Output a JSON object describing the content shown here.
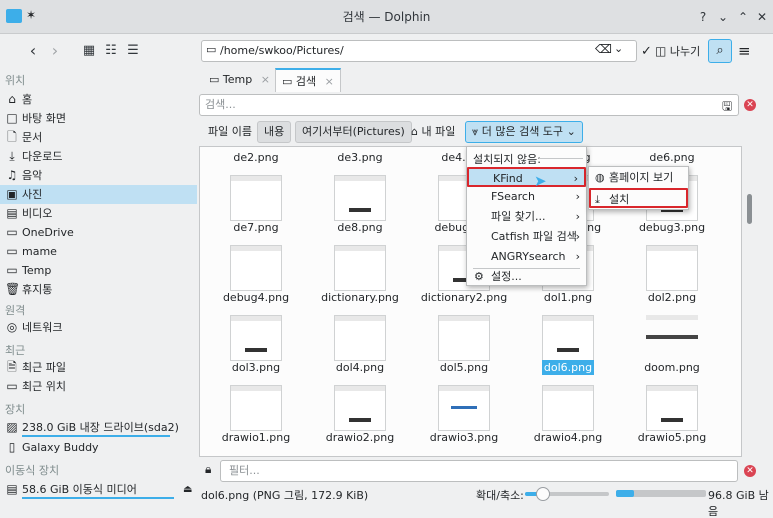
{
  "window": {
    "title": "검색 — Dolphin",
    "controls": [
      "?",
      "⌄",
      "⌃",
      "✕"
    ]
  },
  "toolbar": {
    "path": "/home/swkoo/Pictures/",
    "split_label": "나누기"
  },
  "sidebar": {
    "places_title": "위치",
    "places": [
      {
        "label": "홈",
        "icon": "⌂"
      },
      {
        "label": "바탕 화면",
        "icon": "□"
      },
      {
        "label": "문서",
        "icon": "🗋"
      },
      {
        "label": "다운로드",
        "icon": "⤓"
      },
      {
        "label": "음악",
        "icon": "♫"
      },
      {
        "label": "사진",
        "icon": "▣"
      },
      {
        "label": "비디오",
        "icon": "▤"
      },
      {
        "label": "OneDrive",
        "icon": "▭"
      },
      {
        "label": "mame",
        "icon": "▭"
      },
      {
        "label": "Temp",
        "icon": "▭"
      },
      {
        "label": "휴지통",
        "icon": "🗑"
      }
    ],
    "remote_title": "원격",
    "remote": [
      {
        "label": "네트워크",
        "icon": "◎"
      }
    ],
    "recent_title": "최근",
    "recent": [
      {
        "label": "최근 파일",
        "icon": "🗎"
      },
      {
        "label": "최근 위치",
        "icon": "▭"
      }
    ],
    "devices_title": "장치",
    "devices": [
      {
        "label": "238.0 GiB 내장 드라이브(sda2)",
        "icon": "▨"
      },
      {
        "label": "Galaxy Buddy",
        "icon": "▯"
      }
    ],
    "removable_title": "이동식 장치",
    "removable": [
      {
        "label": "58.6 GiB 이동식 미디어",
        "icon": "▤"
      }
    ]
  },
  "tabs": [
    {
      "label": "Temp",
      "icon": "▭"
    },
    {
      "label": "검색",
      "icon": "▭"
    }
  ],
  "search": {
    "placeholder": "검색..."
  },
  "filter_row": {
    "label_filename": "파일 이름",
    "label_content": "내용",
    "label_from_here": "여기서부터(Pictures)",
    "label_my_files": "내 파일",
    "label_more_tools": "더 많은 검색 도구"
  },
  "files": [
    {
      "name": "de2.png"
    },
    {
      "name": "de3.png"
    },
    {
      "name": "de4.png"
    },
    {
      "name": "de5.png"
    },
    {
      "name": "de6.png"
    },
    {
      "name": "de7.png"
    },
    {
      "name": "de8.png"
    },
    {
      "name": "debug.png"
    },
    {
      "name": "debug2.png"
    },
    {
      "name": "debug3.png"
    },
    {
      "name": "debug4.png"
    },
    {
      "name": "dictionary.png"
    },
    {
      "name": "dictionary2.png"
    },
    {
      "name": "dol1.png"
    },
    {
      "name": "dol2.png"
    },
    {
      "name": "dol3.png"
    },
    {
      "name": "dol4.png"
    },
    {
      "name": "dol5.png"
    },
    {
      "name": "dol6.png"
    },
    {
      "name": "doom.png"
    },
    {
      "name": "drawio1.png"
    },
    {
      "name": "drawio2.png"
    },
    {
      "name": "drawio3.png"
    },
    {
      "name": "drawio4.png"
    },
    {
      "name": "drawio5.png"
    }
  ],
  "menu": {
    "header": "설치되지 않음:",
    "items": [
      {
        "label": "KFind"
      },
      {
        "label": "FSearch"
      },
      {
        "label": "파일 찾기..."
      },
      {
        "label": "Catfish 파일 검색"
      },
      {
        "label": "ANGRYsearch"
      }
    ],
    "settings": "설정..."
  },
  "submenu": {
    "items": [
      {
        "label": "홈페이지 보기"
      },
      {
        "label": "설치"
      }
    ]
  },
  "filterbar": {
    "placeholder": "필터..."
  },
  "status": {
    "file_info": "dol6.png (PNG 그림, 172.9 KiB)",
    "zoom_label": "확대/축소:",
    "zoom_level": 0.22,
    "free_space": "96.8 GiB 남음",
    "free_fraction": 0.2
  },
  "colors": {
    "accent": "#3daee9",
    "highlight": "#bfe0f3",
    "warning": "#da4453"
  }
}
